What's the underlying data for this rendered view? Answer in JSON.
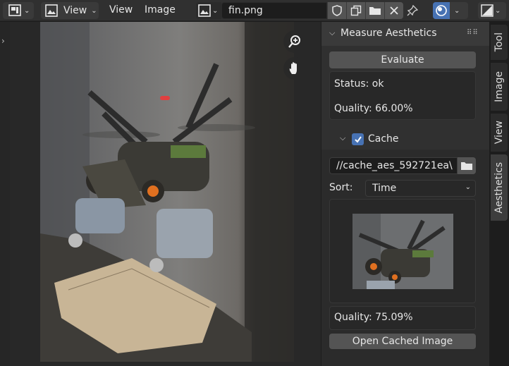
{
  "header": {
    "view_menu_button": "View",
    "menus": [
      "View",
      "Image"
    ],
    "image_name": "fin.png"
  },
  "panel": {
    "title": "Measure Aesthetics",
    "evaluate_label": "Evaluate",
    "status": "Status: ok",
    "quality": "Quality: 66.00%",
    "cache_label": "Cache",
    "cache_checked": true,
    "cache_path": "//cache_aes_592721ea\\",
    "sort_label": "Sort:",
    "sort_value": "Time",
    "cached_quality": "Quality: 75.09%",
    "open_cached_label": "Open Cached Image"
  },
  "tabs": [
    "Tool",
    "Image",
    "View",
    "Aesthetics"
  ],
  "colors": {
    "accent": "#4772b3",
    "panel_bg": "#303030",
    "button_bg": "#545454"
  }
}
